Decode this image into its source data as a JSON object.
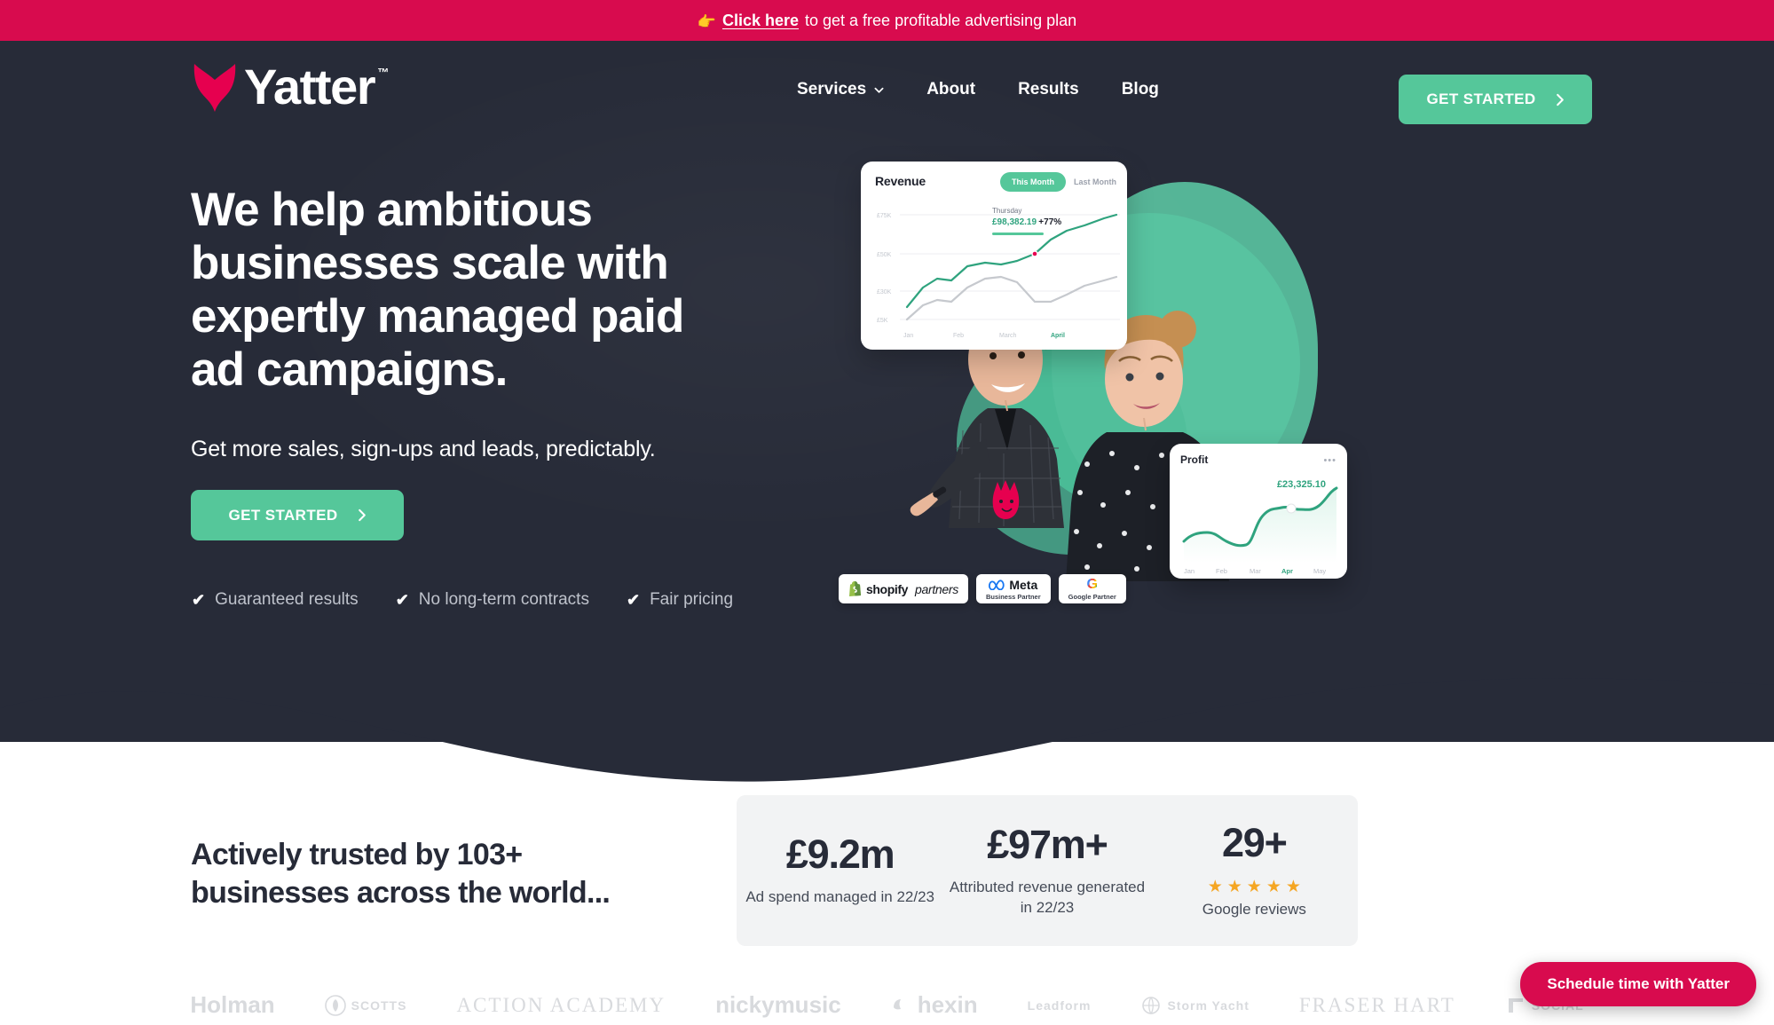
{
  "announcement": {
    "emoji": "👉",
    "link_text": "Click here",
    "rest_text": "to get a free profitable advertising plan",
    "background": "#D80B4E"
  },
  "header": {
    "logo_text": "Yatter",
    "logo_tm": "™",
    "nav": [
      {
        "label": "Services",
        "has_dropdown": true
      },
      {
        "label": "About",
        "has_dropdown": false
      },
      {
        "label": "Results",
        "has_dropdown": false
      },
      {
        "label": "Blog",
        "has_dropdown": false
      }
    ],
    "cta_label": "GET STARTED"
  },
  "hero": {
    "heading": "We help ambitious businesses scale with expertly managed paid ad campaigns.",
    "subheading": "Get more sales, sign-ups and leads, predictably.",
    "cta_label": "GET STARTED",
    "features": [
      "Guaranteed results",
      "No long-term contracts",
      "Fair pricing"
    ],
    "background": "#272B38",
    "accent_green": "#55C79A"
  },
  "revenue_card": {
    "title": "Revenue",
    "toggle_active": "This Month",
    "toggle_inactive": "Last Month",
    "tooltip_day": "Thursday",
    "tooltip_value": "£98,382.19",
    "tooltip_change": "+77%"
  },
  "profit_card": {
    "title": "Profit",
    "menu": "•••",
    "value": "£23,325.10"
  },
  "badges": [
    {
      "name": "shopify partners",
      "word1": "shopify",
      "word2": "partners"
    },
    {
      "name": "Meta Business Partner",
      "word1": "Meta",
      "sub": "Business Partner"
    },
    {
      "name": "Google Partner",
      "letter": "G",
      "sub": "Google Partner"
    }
  ],
  "trust": {
    "heading": "Actively trusted by 103+ businesses across the world...",
    "stats": [
      {
        "value": "£9.2m",
        "label": "Ad spend managed in 22/23"
      },
      {
        "value": "£97m+",
        "label": "Attributed revenue generated in 22/23"
      },
      {
        "value": "29+",
        "label": "Google reviews",
        "stars": 5,
        "star_color": "#F5A623"
      }
    ]
  },
  "client_logos": [
    "Holman",
    "SCOTTS",
    "ACTION ACADEMY",
    "nickymusic",
    "hexin",
    "Leadform",
    "Storm Yacht",
    "FRASER HART",
    "SOCIAL"
  ],
  "chat_widget": {
    "label": "Schedule time with Yatter",
    "background": "#D80B4E"
  },
  "chart_data": [
    {
      "type": "line",
      "title": "Revenue",
      "x": [
        "Jan",
        "Feb",
        "March",
        "April"
      ],
      "ytick_labels": [
        "£75K",
        "£50K",
        "£30K",
        "£5K"
      ],
      "ylim": [
        0,
        80
      ],
      "grid": true,
      "legend": "none",
      "series": [
        {
          "name": "This Month",
          "color": "#2FA37E",
          "values": [
            22,
            33,
            42,
            44,
            47,
            52,
            62,
            70
          ]
        },
        {
          "name": "Last Month",
          "color": "#C6C9CE",
          "values": [
            15,
            26,
            28,
            30,
            45,
            44,
            30,
            33
          ]
        }
      ],
      "annotation": {
        "label": "Thursday",
        "value": "£98,382.19",
        "change": "+77%"
      }
    },
    {
      "type": "line",
      "title": "Profit",
      "x": [
        "Jan",
        "Feb",
        "Mar",
        "Apr",
        "May"
      ],
      "highlight_x": "Apr",
      "grid": false,
      "legend": "none",
      "series": [
        {
          "name": "Profit",
          "color": "#2FA37E",
          "values": [
            28,
            34,
            30,
            26,
            24,
            50,
            58,
            62,
            60,
            63,
            78
          ]
        }
      ],
      "annotation": {
        "value": "£23,325.10"
      }
    }
  ]
}
